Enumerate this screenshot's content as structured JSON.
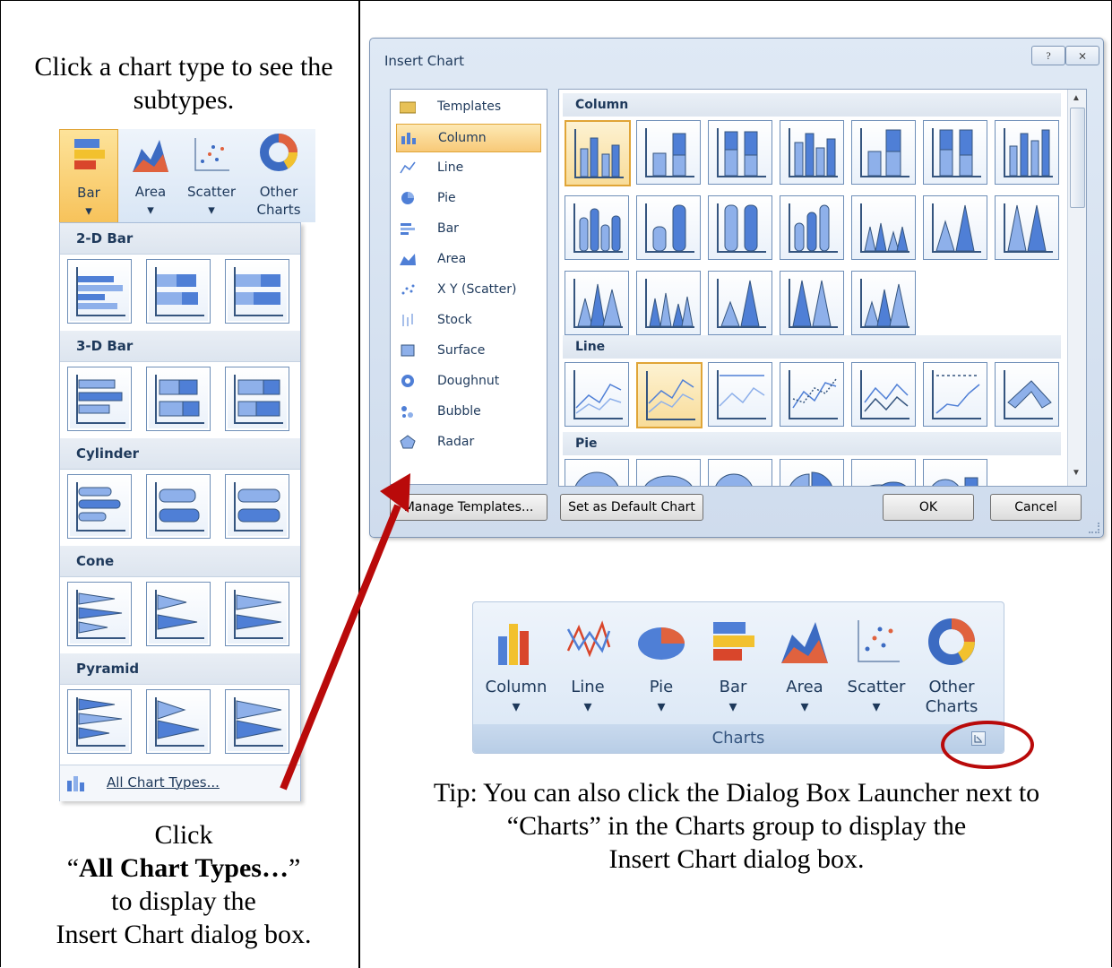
{
  "left_panel": {
    "caption_top": "Click a chart type to see the subtypes.",
    "ribbon_buttons": [
      "Bar",
      "Area",
      "Scatter",
      "Other\nCharts"
    ],
    "sections": [
      "2-D Bar",
      "3-D Bar",
      "Cylinder",
      "Cone",
      "Pyramid"
    ],
    "footer_link": "All Chart Types...",
    "caption_bottom_1": "Click",
    "caption_bottom_bold": "All Chart Types…",
    "caption_bottom_2": "to display the",
    "caption_bottom_3": "Insert Chart dialog box."
  },
  "dialog": {
    "title": "Insert Chart",
    "help_glyph": "?",
    "close_glyph": "⨯",
    "categories": [
      "Templates",
      "Column",
      "Line",
      "Pie",
      "Bar",
      "Area",
      "X Y (Scatter)",
      "Stock",
      "Surface",
      "Doughnut",
      "Bubble",
      "Radar"
    ],
    "selected_category": "Column",
    "gallery_sections": [
      "Column",
      "Line",
      "Pie"
    ],
    "manage_templates": "Manage Templates...",
    "set_default": "Set as Default Chart",
    "ok": "OK",
    "cancel": "Cancel"
  },
  "ribbon": {
    "buttons": [
      "Column",
      "Line",
      "Pie",
      "Bar",
      "Area",
      "Scatter",
      "Other\nCharts"
    ],
    "group_label": "Charts"
  },
  "tip": {
    "line1": "Tip: You can also click the Dialog Box Launcher next to",
    "line2": "“Charts” in the Charts group to display the",
    "line3": "Insert Chart dialog box."
  },
  "colors": {
    "arrow": "#b90a0a",
    "selection": "#f8c978"
  }
}
